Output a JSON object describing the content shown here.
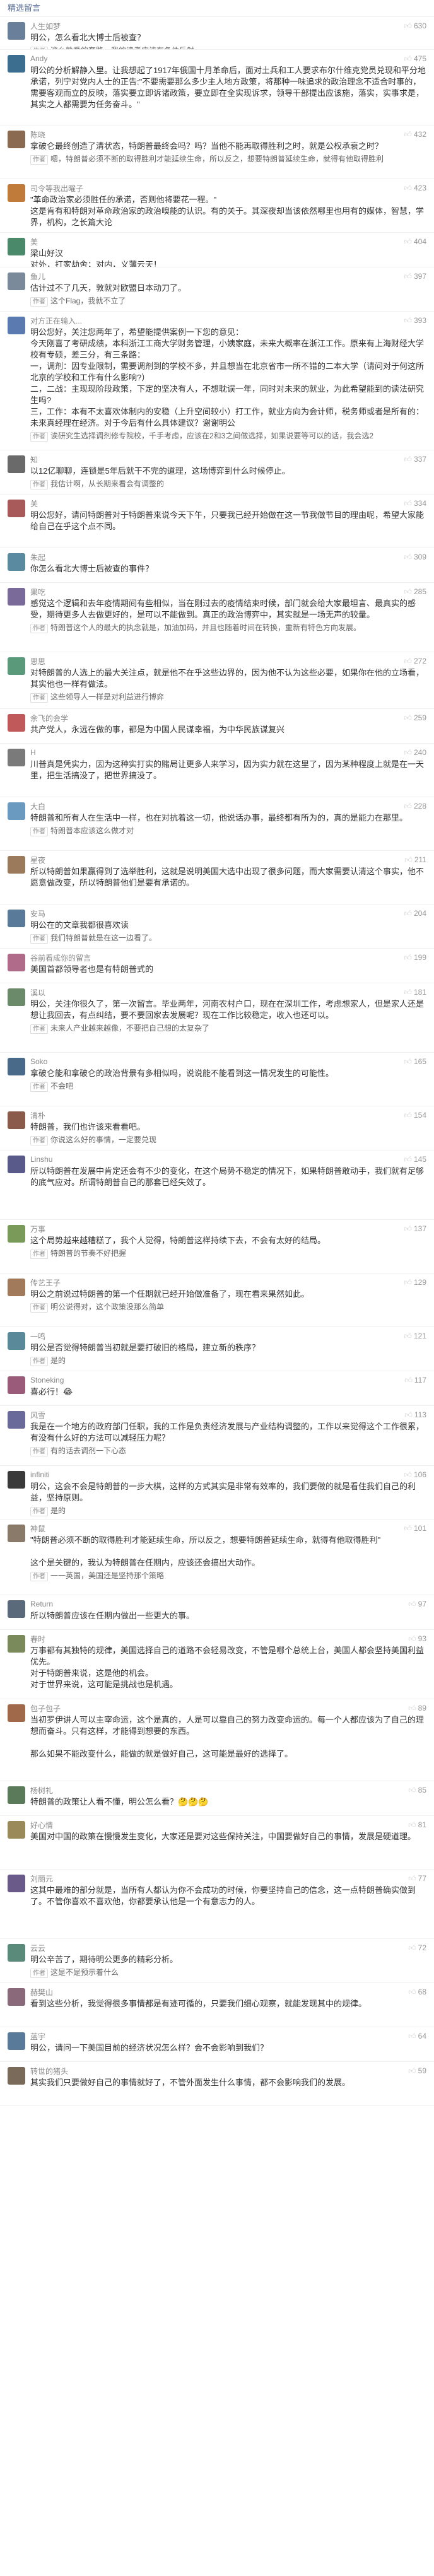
{
  "header": {
    "title": "精选留言"
  },
  "author_tag": "作者",
  "thumb_icon": "thumb-up-icon",
  "comments": [
    {
      "name": "人生如梦",
      "likes": "630",
      "color": "#6a7f9a",
      "text": "明公，怎么看北大博士后被查？",
      "reply": "这么熟悉的套路，我的读者应该有条件反射……"
    },
    {
      "name": "Andy",
      "likes": "475",
      "color": "#3b6e8f",
      "text": "明公的分析解静入里。让我想起了1917年俄国十月革命后，面对土兵和工人要求布尔什维克党员兑现和平分地承诺，列宁对党内人士的正告:\"不要需要那么多少主人地方政策，将那种一味追求的政治理念不适合时事的，需要客观而立的反映，落实要立即诉诸政策，要立即在全实现诉求，领导干部提出应该施，落实，实事求是，其实之人都需要为任务奋斗。\"",
      "reply": ""
    },
    {
      "name": "陈晓",
      "likes": "432",
      "color": "#8a6a50",
      "text": "拿破仑最终创造了清状态，特朗普最终会吗？吗？当他不能再取得胜利之时，就是公权承衰之时？",
      "reply": "嗯，特朗普必须不断的取得胜利才能延续生命，所以反之，想要特朗普延续生命，就得有他取得胜利"
    },
    {
      "name": "司令等我出曜子",
      "likes": "423",
      "color": "#c07a3a",
      "text": "\"革命政治家必须胜任的承诺，否则他将要花一程。\"\n这是肯有和特朗对革命政治家的政治嗅能的认识。有的关于。其深夜却当该依然哪里也用有的媒体，智慧，学界，机构，之长篇大论",
      "reply": ""
    },
    {
      "name": "美",
      "likes": "404",
      "color": "#4a8a6a",
      "text": "梁山好汉\n对外，打家劫舍；对内，义薄云天！",
      "reply": ""
    },
    {
      "name": "鱼儿",
      "likes": "397",
      "color": "#7a8a9a",
      "text": "估计过不了几天，敦就对欧盟日本动刀了。",
      "reply": "这个Flag，我就不立了"
    },
    {
      "name": "对方正在输入...",
      "likes": "393",
      "color": "#5a7ab0",
      "text": "明公您好，关注您两年了，希望能提供案例一下您的意见：\n今天刚喜了考研成绩，本科浙江工商大学财务管理，小姨家庭，未来大概率在浙江工作。原来有上海财经大学校有专硕，差三分，有三条路：\n一，调剂：因专业限制，需要调剂到的学校不多，并且想当在北京省市一所不错的二本大学（请问对于何这所北京的学校和工作有什么影响?）\n二，二战：主现现阶段政策，下定的坚决有人，不想耽误一年，同时对未来的就业，为此希望能到的读法研究生吗?\n三，工作：本有不太喜欢体制内的安稳（上升空间较小）打工作，就业方向为会计师，税务师或者是所有的：未来真经理在经济。对于今后有什么具体建议？谢谢明公",
      "reply": "诶研究生选择调剂修专院校，千手考虑，应该在2和3之间做选择，如果说要等可以的话，我会选2"
    },
    {
      "name": "知",
      "likes": "337",
      "color": "#6a6a6a",
      "text": "以12亿聊聊，连锁是5年后就干不完的道理，这场博弈到什么时候停止。",
      "reply": "我估计啊，从长期来看会有调整的"
    },
    {
      "name": "关",
      "likes": "334",
      "color": "#a85a5a",
      "text": "明公您好，请问特朗普对于特朗普来说今天下午，只要我已经开始做在这一节我做节目的理由呢，希望大家能给自己在乎这个点不同。",
      "reply": ""
    },
    {
      "name": "朱起",
      "likes": "309",
      "color": "#5a8aa0",
      "text": "你怎么看北大博士后被查的事件？",
      "reply": ""
    },
    {
      "name": "果吃",
      "likes": "285",
      "color": "#7a6a9a",
      "text": "感觉这个逻辑和去年疫情期间有些相似，当在刚过去的疫情结束时候，部门就会给大家最坦言、最真实的感受，期待更多人去做更好的，是可以不能做到。真正的政治博弈中，其实就是一场无声的较量。",
      "reply": "特朗普这个人的最大的执念就是，加油加码，并且也随着时间在转换，重新有特色方向发展。"
    },
    {
      "name": "思思",
      "likes": "272",
      "color": "#5a9a7a",
      "text": "对特朗普的人选上的最大关注点，就是他不在乎这些边界的，因为他不认为这些必要，如果你在他的立场看，其实他也一样有做法。",
      "reply": "这些领导人一样是对利益进行博弈"
    },
    {
      "name": "余飞的会学",
      "likes": "259",
      "color": "#c05a5a",
      "text": "共产党人，永远在做的事，都是为中国人民谋幸福，为中华民族谋复兴",
      "reply": ""
    },
    {
      "name": "H",
      "likes": "240",
      "color": "#7a7a7a",
      "text": "川普真是凭实力，因为这种实打实的赌局让更多人来学习，因为实力就在这里了，因为某种程度上就是在一天里，把生活搞没了，把世界搞没了。",
      "reply": ""
    },
    {
      "name": "大白",
      "likes": "228",
      "color": "#6a9ac0",
      "text": "特朗普和所有人在生活中一样，也在对抗着这一切，他说话办事，最终都有所为的，真的是能力在那里。",
      "reply": "特朗普本应该这么做才对"
    },
    {
      "name": "星夜",
      "likes": "211",
      "color": "#9a7a5a",
      "text": "所以特朗普如果赢得到了选举胜利，这就是说明美国大选中出现了很多问题，而大家需要认清这个事实，他不愿意做改变，所以特朗普他们是要有承诺的。",
      "reply": ""
    },
    {
      "name": "安马",
      "likes": "204",
      "color": "#5a7a9a",
      "text": "明公在的文章我都很喜欢读",
      "reply": "我们特朗普就是在这一边看了。"
    },
    {
      "name": "谷前看成你的留言",
      "likes": "199",
      "color": "#b06a8a",
      "text": "美国首都领导者也是有特朗普式的",
      "reply": ""
    },
    {
      "name": "溪以",
      "likes": "181",
      "color": "#6a8a6a",
      "text": "明公，关注你很久了，第一次留言。毕业两年，河南农村户口，现在在深圳工作，考虑想家人，但是家人还是想让我回去，有点纠结，要不要回家去发展呢？现在工作比较稳定，收入也还可以。",
      "reply": "未来人产业越来越像，不要把自己想的太复杂了"
    },
    {
      "name": "Soko",
      "likes": "165",
      "color": "#4a6a8a",
      "text": "拿破仑能和拿破仑的政治背景有多相似吗，说说能不能看到这一情况发生的可能性。",
      "reply": "不会吧"
    },
    {
      "name": "清朴",
      "likes": "154",
      "color": "#8a5a4a",
      "text": "特朗普，我们也许该来看看吧。",
      "reply": "你说这么好的事情，一定要兑现"
    },
    {
      "name": "Linshu",
      "likes": "145",
      "color": "#5a5a8a",
      "text": "所以特朗普在发展中肯定还会有不少的变化，在这个局势不稳定的情况下，如果特朗普敢动手，我们就有足够的底气应对。所谓特朗普自己的那套已经失效了。",
      "reply": ""
    },
    {
      "name": "万事",
      "likes": "137",
      "color": "#7a9a5a",
      "text": "这个局势越来越糟糕了，我个人觉得，特朗普这样持续下去，不会有太好的结局。",
      "reply": "特朗普的节奏不好把握"
    },
    {
      "name": "传艺王子",
      "likes": "129",
      "color": "#a07a5a",
      "text": "明公之前说过特朗普的第一个任期就已经开始做准备了，现在看来果然如此。",
      "reply": "明公说得对，这个政策没那么简单"
    },
    {
      "name": "一鸣",
      "likes": "121",
      "color": "#5a8a9a",
      "text": "明公是否觉得特朗普当初就是要打破旧的格局，建立新的秩序？",
      "reply": "是的"
    },
    {
      "name": "Stoneking",
      "likes": "117",
      "color": "#9a5a7a",
      "text": "喜必行！😂",
      "reply": ""
    },
    {
      "name": "风雪",
      "likes": "113",
      "color": "#6a6a9a",
      "text": "我是在一个地方的政府部门任职，我的工作是负责经济发展与产业结构调整的，工作以来觉得这个工作很累，有没有什么好的方法可以减轻压力呢？",
      "reply": "有的话去调剂一下心态"
    },
    {
      "name": "infiniti",
      "likes": "106",
      "color": "#3a3a3a",
      "text": "明公，这会不会是特朗普的一步大棋，这样的方式其实是非常有效率的，我们要做的就是看住我们自己的利益，坚持原则。",
      "reply": "是的"
    },
    {
      "name": "神鼠",
      "likes": "101",
      "color": "#8a7a6a",
      "text": "\"特朗普必须不断的取得胜利才能延续生命，所以反之，想要特朗普延续生命，就得有他取得胜利\"\n\n这个是关键的，我认为特朗普在任期内，应该还会搞出大动作。",
      "reply": "一一英国，美国还是坚持那个策略"
    },
    {
      "name": "Return",
      "likes": "97",
      "color": "#5a6a7a",
      "text": "所以特朗普应该在任期内做出一些更大的事。",
      "reply": ""
    },
    {
      "name": "春时",
      "likes": "93",
      "color": "#7a8a5a",
      "text": "万事都有其独特的规律，美国选择自己的道路不会轻易改变，不管是哪个总统上台，美国人都会坚持美国利益优先。\n对于特朗普来说，这是他的机会。\n对于世界来说，这可能是挑战也是机遇。",
      "reply": ""
    },
    {
      "name": "包子包子",
      "likes": "89",
      "color": "#a06a4a",
      "text": "当初罗伊讲人可以主宰命运，这个是真的，人是可以靠自己的努力改变命运的。每一个人都应该为了自己的理想而奋斗。只有这样，才能得到想要的东西。\n\n那么如果不能改变什么，能做的就是做好自己，这可能是最好的选择了。",
      "reply": ""
    },
    {
      "name": "杨树礼",
      "likes": "85",
      "color": "#5a7a5a",
      "text": "特朗普的政策让人看不懂，明公怎么看？🤔🤔🤔",
      "reply": ""
    },
    {
      "name": "好心情",
      "likes": "81",
      "color": "#9a8a5a",
      "text": "美国对中国的政策在慢慢发生变化，大家还是要对这些保持关注，中国要做好自己的事情，发展是硬道理。",
      "reply": ""
    },
    {
      "name": "刘丽元",
      "likes": "77",
      "color": "#6a5a8a",
      "text": "这其中最难的部分就是，当所有人都认为你不会成功的时候，你要坚持自己的信念，这一点特朗普确实做到了。不管你喜欢不喜欢他，你都要承认他是一个有意志力的人。",
      "reply": ""
    },
    {
      "name": "云云",
      "likes": "72",
      "color": "#5a8a7a",
      "text": "明公辛苦了，期待明公更多的精彩分析。",
      "reply": "这是不是预示着什么"
    },
    {
      "name": "赫樊山",
      "likes": "68",
      "color": "#8a6a7a",
      "text": "看到这些分析，我觉得很多事情都是有迹可循的，只要我们细心观察，就能发现其中的规律。",
      "reply": ""
    },
    {
      "name": "蓝宇",
      "likes": "64",
      "color": "#5a7a9a",
      "text": "明公，请问一下美国目前的经济状况怎么样？会不会影响到我们？",
      "reply": ""
    },
    {
      "name": "转世的猪头",
      "likes": "59",
      "color": "#7a6a5a",
      "text": "其实我们只要做好自己的事情就好了，不管外面发生什么事情，都不会影响我们的发展。",
      "reply": ""
    }
  ]
}
